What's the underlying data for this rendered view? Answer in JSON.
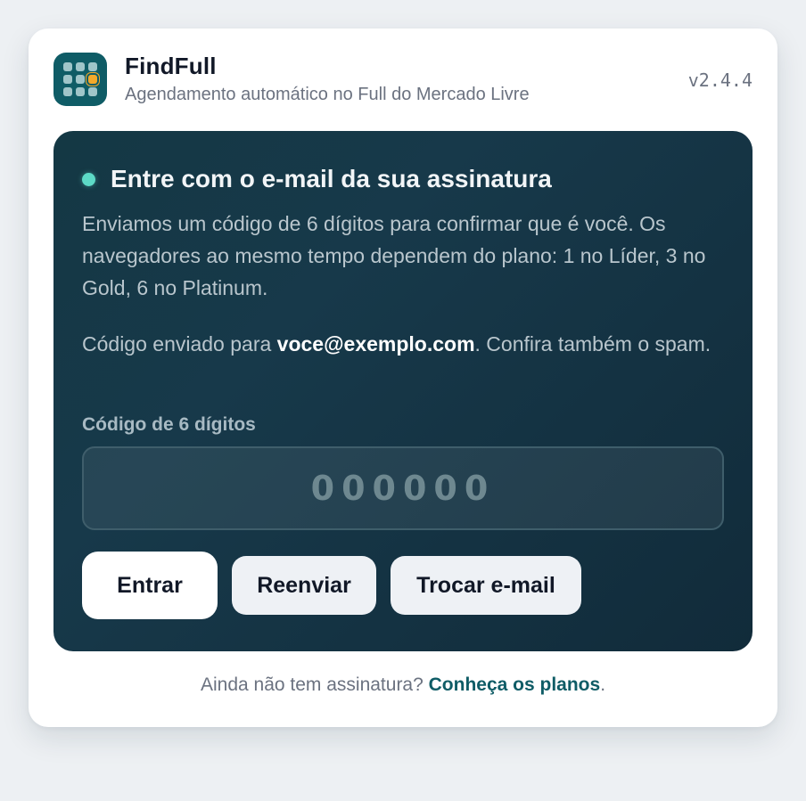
{
  "app": {
    "name": "FindFull",
    "subtitle": "Agendamento automático no Full do Mercado Livre",
    "version": "v2.4.4",
    "logo_icon": "grid-apps-icon"
  },
  "login": {
    "title": "Entre com o e-mail da sua assinatura",
    "description": "Enviamos um código de 6 dígitos para confirmar que é você. Os navegadores ao mesmo tempo dependem do plano: 1 no Líder, 3 no Gold, 6 no Platinum.",
    "sent_prefix": "Código enviado para ",
    "sent_email": "voce@exemplo.com",
    "sent_suffix": ". Confira também o spam.",
    "code_label": "Código de 6 dígitos",
    "code_placeholder": "000000",
    "code_value": ""
  },
  "buttons": {
    "enter": "Entrar",
    "resend": "Reenviar",
    "change_email": "Trocar e-mail"
  },
  "footer": {
    "text": "Ainda não tem assinatura? ",
    "link": "Conheça os planos",
    "suffix": "."
  },
  "colors": {
    "brand": "#0f5c66",
    "panel_bg": "#143844",
    "status_dot": "#5ddac6",
    "logo_accent": "#f4a92a"
  }
}
